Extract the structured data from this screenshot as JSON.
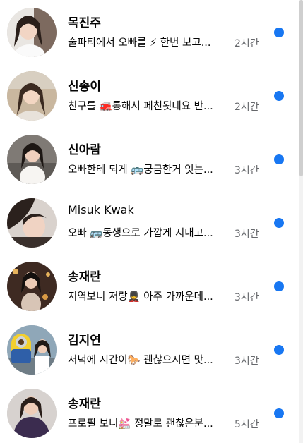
{
  "conversations": [
    {
      "name": "목진주",
      "snippet": "술파티에서 오빠를 ⚡ 한번 보고...",
      "time": "2시간",
      "unread": true,
      "avatar_bg": "#6b5a52"
    },
    {
      "name": "신송이",
      "snippet": "친구를 🚒통해서 페친됫네요 반...",
      "time": "2시간",
      "unread": true,
      "avatar_bg": "#9a8570"
    },
    {
      "name": "신아람",
      "snippet": "오빠한테 되게 🚌궁금한거 잇는...",
      "time": "3시간",
      "unread": true,
      "avatar_bg": "#4e4b4a"
    },
    {
      "name": "Misuk Kwak",
      "snippet": "오빠 🚌동생으로 가깝게 지내고...",
      "time": "3시간",
      "unread": true,
      "avatar_bg": "#3f3531"
    },
    {
      "name": "송재란",
      "snippet": "지역보니 저랑💂 아주 가까운데...",
      "time": "3시간",
      "unread": true,
      "avatar_bg": "#5b3b2f"
    },
    {
      "name": "김지연",
      "snippet": "저녁에 시간이🐎 괜찮으시면 맛...",
      "time": "3시간",
      "unread": true,
      "avatar_bg": "#d3b53a"
    },
    {
      "name": "송재란",
      "snippet": "프로필 보니💒 정말로 괜찮은분...",
      "time": "5시간",
      "unread": true,
      "avatar_bg": "#3a2f45"
    }
  ],
  "unread_dot_color": "#1877f2"
}
